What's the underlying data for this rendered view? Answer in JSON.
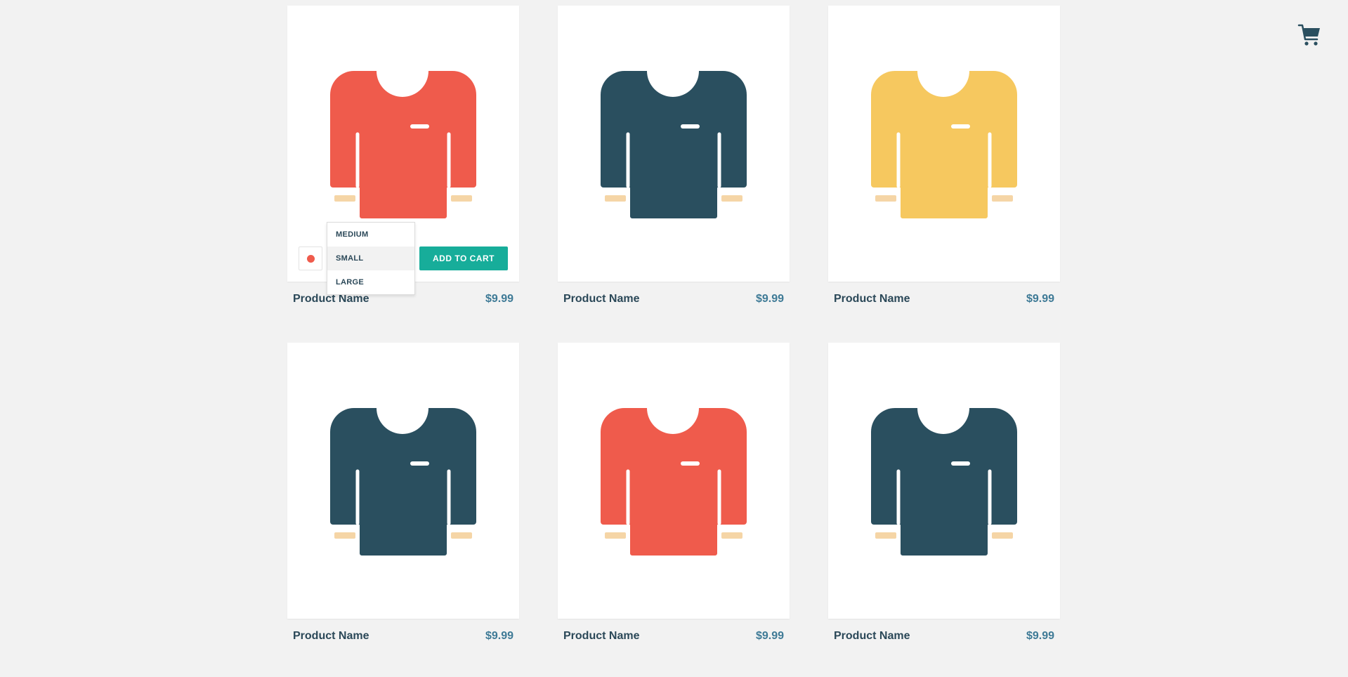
{
  "colors": {
    "red": "#ef5b4c",
    "navy": "#2a4f5f",
    "yellow": "#f6c85f",
    "cuff": "#f5d5a6",
    "accent": "#17ad9a",
    "price": "#3e7a96"
  },
  "cart": {
    "icon": "cart-icon"
  },
  "products": [
    {
      "name": "Product Name",
      "price": "$9.99",
      "color": "#ef5b4c"
    },
    {
      "name": "Product Name",
      "price": "$9.99",
      "color": "#2a4f5f"
    },
    {
      "name": "Product Name",
      "price": "$9.99",
      "color": "#f6c85f"
    },
    {
      "name": "Product Name",
      "price": "$9.99",
      "color": "#2a4f5f"
    },
    {
      "name": "Product Name",
      "price": "$9.99",
      "color": "#ef5b4c"
    },
    {
      "name": "Product Name",
      "price": "$9.99",
      "color": "#2a4f5f"
    }
  ],
  "controls": {
    "selected_color": "#ef5b4c",
    "sizes": [
      "MEDIUM",
      "SMALL",
      "LARGE"
    ],
    "selected_size": "SMALL",
    "add_to_cart_label": "ADD TO CART"
  }
}
